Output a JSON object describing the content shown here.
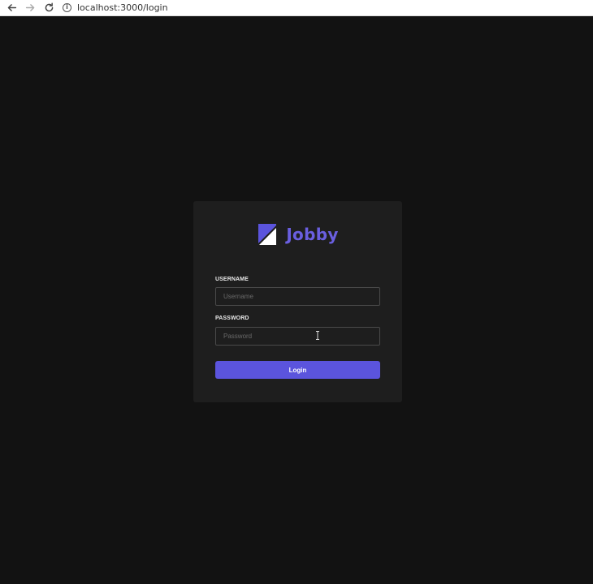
{
  "browser": {
    "url": "localhost:3000/login"
  },
  "brand": {
    "name": "Jobby"
  },
  "form": {
    "username_label": "USERNAME",
    "username_placeholder": "Username",
    "username_value": "",
    "password_label": "PASSWORD",
    "password_placeholder": "Password",
    "password_value": "",
    "login_label": "Login"
  },
  "colors": {
    "accent": "#5b54dd",
    "background": "#121212",
    "card": "#1e1e1e"
  }
}
